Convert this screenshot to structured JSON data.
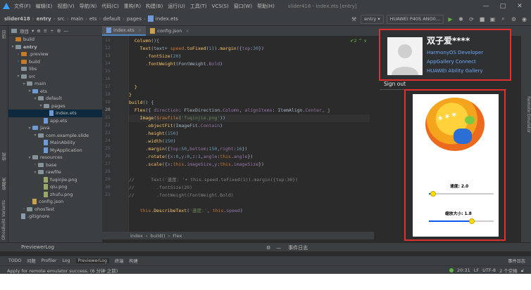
{
  "menu": {
    "items": [
      "文件(F)",
      "编辑(E)",
      "视图(V)",
      "导航(N)",
      "代码(C)",
      "重构(R)",
      "构建(B)",
      "运行(U)",
      "工具(T)",
      "VCS(S)",
      "窗口(W)",
      "帮助(H)"
    ],
    "title": "slider418 - index.ets [entry]",
    "controls": [
      "—",
      "□",
      "✕"
    ]
  },
  "nav": {
    "crumbs": [
      "slider418",
      "entry",
      "src",
      "main",
      "ets",
      "default",
      "pages",
      "index.ets"
    ],
    "run_config": "entry",
    "device": "HUAWEI P40 ...",
    "device_full": "HUAWEI P40S ANO0..."
  },
  "left_strip": {
    "project": "项目",
    "structure": "结构",
    "favorites": "收藏夹",
    "variants": "OhosBuild Variants"
  },
  "project": {
    "header": "项目",
    "tree": [
      {
        "label": "build",
        "indent": 0,
        "type": "folder-or",
        "arrow": ""
      },
      {
        "label": "entry",
        "indent": 0,
        "type": "folder",
        "arrow": "▾",
        "bold": true
      },
      {
        "label": ".preview",
        "indent": 1,
        "type": "folder-or",
        "arrow": "›"
      },
      {
        "label": "build",
        "indent": 1,
        "type": "folder-or",
        "arrow": "›"
      },
      {
        "label": "libs",
        "indent": 1,
        "type": "folder",
        "arrow": ""
      },
      {
        "label": "src",
        "indent": 1,
        "type": "folder",
        "arrow": "▾"
      },
      {
        "label": "main",
        "indent": 2,
        "type": "folder",
        "arrow": "▾"
      },
      {
        "label": "ets",
        "indent": 3,
        "type": "folder-bl",
        "arrow": "▾"
      },
      {
        "label": "default",
        "indent": 4,
        "type": "folder",
        "arrow": "▾"
      },
      {
        "label": "pages",
        "indent": 5,
        "type": "folder",
        "arrow": "▾"
      },
      {
        "label": "index.ets",
        "indent": 6,
        "type": "file-ets",
        "arrow": "",
        "selected": true
      },
      {
        "label": "app.ets",
        "indent": 5,
        "type": "file-ets",
        "arrow": ""
      },
      {
        "label": "java",
        "indent": 3,
        "type": "folder-bl",
        "arrow": "▾"
      },
      {
        "label": "com.example.slide",
        "indent": 4,
        "type": "folder",
        "arrow": "▾"
      },
      {
        "label": "MainAbility",
        "indent": 5,
        "type": "file-ets",
        "arrow": ""
      },
      {
        "label": "MyApplication",
        "indent": 5,
        "type": "file-ets",
        "arrow": ""
      },
      {
        "label": "resources",
        "indent": 3,
        "type": "folder",
        "arrow": "▾"
      },
      {
        "label": "base",
        "indent": 4,
        "type": "folder",
        "arrow": "›"
      },
      {
        "label": "rawfile",
        "indent": 4,
        "type": "folder",
        "arrow": "▾"
      },
      {
        "label": "fuqinjie.png",
        "indent": 5,
        "type": "file-img",
        "arrow": ""
      },
      {
        "label": "qiu.png",
        "indent": 5,
        "type": "file-img",
        "arrow": ""
      },
      {
        "label": "zhufu.png",
        "indent": 5,
        "type": "file-img",
        "arrow": ""
      },
      {
        "label": "config.json",
        "indent": 3,
        "type": "file-json",
        "arrow": ""
      },
      {
        "label": "ohosTest",
        "indent": 2,
        "type": "folder",
        "arrow": "›"
      },
      {
        "label": ".gitignore",
        "indent": 1,
        "type": "file",
        "arrow": ""
      }
    ]
  },
  "editor": {
    "tabs": [
      {
        "label": "index.ets",
        "active": true
      },
      {
        "label": "config.json",
        "active": false
      }
    ],
    "inspection": "✔2 ^ ∨",
    "line_numbers": [
      "11",
      "12",
      "13",
      "14",
      "15",
      "16",
      "17",
      "18",
      "19",
      "20",
      "21",
      "22",
      "23",
      "24",
      "25",
      "26",
      "27",
      "28",
      "29",
      "30",
      "31"
    ],
    "current_line_index": 9,
    "breadcrumb": [
      "Index",
      "build()",
      "Flex"
    ]
  },
  "preview": {
    "account_name": "双子爱****",
    "links": [
      "HarmonyOS Developer",
      "AppGallery Connect",
      "HUAWEI Ability Gallery"
    ],
    "sign_out": "Sign out",
    "emulator_label": "Remote Emulator",
    "labels": {
      "speed": "速度: 2.0",
      "scale": "缩放大小: 1.8"
    },
    "slider_speed": 0.06,
    "slider_scale": 0.66
  },
  "bottom": {
    "panel_title": "PreviewerLog",
    "event_log": "事件日志",
    "tools": [
      "TODO",
      "问题",
      "Profiler",
      "Log",
      "PreviewerLog",
      "终端",
      "构建"
    ],
    "active_tool": "PreviewerLog",
    "event_badge": "事件日志",
    "status_msg": "Apply for remote emulator success. (6 分钟 之前)",
    "status_right": [
      "20:31",
      "LF",
      "UTF-8",
      "2 个空格"
    ]
  }
}
